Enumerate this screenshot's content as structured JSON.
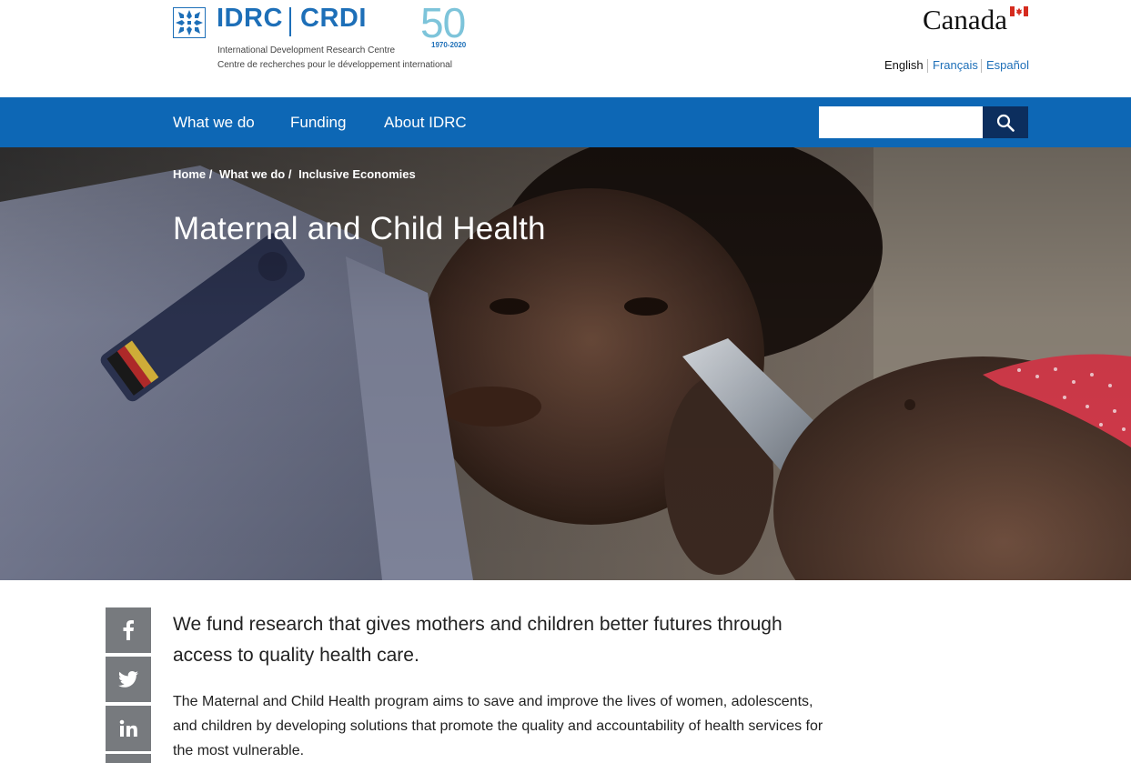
{
  "header": {
    "logo_icon": "idrc-snowflake-icon",
    "logo_idrc": "IDRC",
    "logo_crdi": "CRDI",
    "org_name_en": "International Development Research Centre",
    "org_name_fr": "Centre de recherches pour le développement international",
    "anniversary_number": "50",
    "anniversary_years": "1970-2020",
    "wordmark": "Canada",
    "flag_icon": "canada-flag-icon",
    "languages": [
      "English",
      "Français",
      "Español"
    ]
  },
  "nav": {
    "items": [
      "What we do",
      "Funding",
      "About IDRC"
    ],
    "search_placeholder": "",
    "search_icon": "search-icon"
  },
  "hero": {
    "breadcrumb": [
      "Home",
      "What we do",
      "Inclusive Economies"
    ],
    "breadcrumb_separator": "/",
    "title": "Maternal and Child Health"
  },
  "social": {
    "icons": [
      "facebook-icon",
      "twitter-icon",
      "linkedin-icon"
    ]
  },
  "content": {
    "lead": "We fund research that gives mothers and children better futures through access to quality health care.",
    "body": "The Maternal and Child Health program aims to save and improve the lives of women, adolescents, and children by developing solutions that promote the quality and accountability of health services for the most vulnerable."
  },
  "colors": {
    "brand_blue": "#0d67b5",
    "search_button": "#0c2e5e",
    "anniversary_teal": "#7dc4da",
    "social_grey": "#777a7e"
  }
}
